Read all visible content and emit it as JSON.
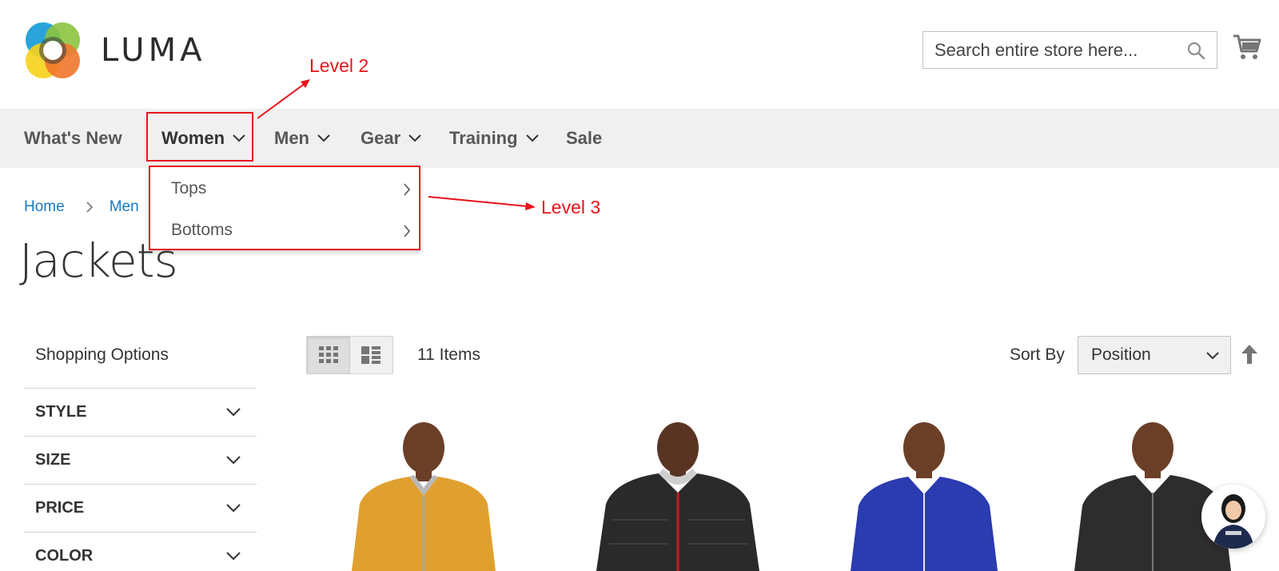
{
  "header": {
    "logo_text": "LUMA",
    "search": {
      "placeholder": "Search entire store here..."
    }
  },
  "nav": {
    "items": [
      {
        "label": "What's New"
      },
      {
        "label": "Women"
      },
      {
        "label": "Men"
      },
      {
        "label": "Gear"
      },
      {
        "label": "Training"
      },
      {
        "label": "Sale"
      }
    ],
    "submenu": [
      {
        "label": "Tops"
      },
      {
        "label": "Bottoms"
      }
    ]
  },
  "annotations": {
    "level2": "Level 2",
    "level3": "Level 3",
    "color": "#e8141a"
  },
  "breadcrumb": {
    "items": [
      "Home",
      "Men"
    ]
  },
  "page": {
    "title": "Jackets"
  },
  "sidebar": {
    "title": "Shopping Options",
    "filters": [
      "STYLE",
      "SIZE",
      "PRICE",
      "COLOR"
    ]
  },
  "toolbar": {
    "amount": "11 Items",
    "sort_label": "Sort By",
    "sort_value": "Position"
  },
  "products": [
    {
      "jacket_color": "#e0a02f"
    },
    {
      "jacket_color": "#2a2a2a"
    },
    {
      "jacket_color": "#2b3bb0"
    },
    {
      "jacket_color": "#2d2d2d"
    }
  ],
  "colors": {
    "link": "#1979c3",
    "nav_bg": "#f0f0f0"
  }
}
